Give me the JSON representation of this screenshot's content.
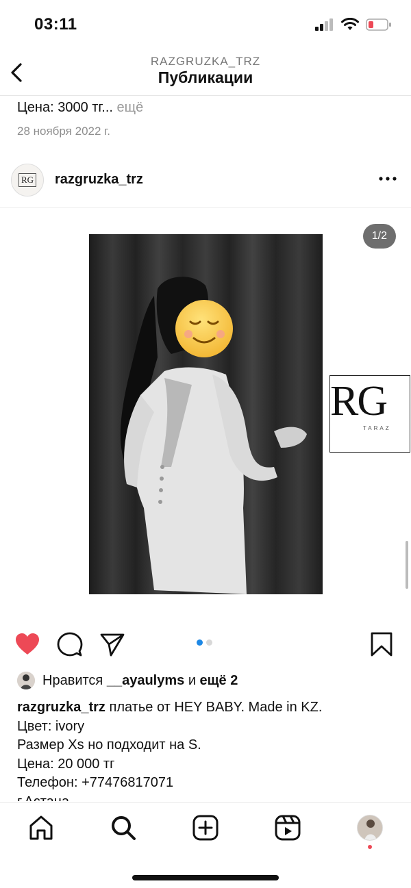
{
  "status_bar": {
    "time": "03:11"
  },
  "header": {
    "username": "RAZGRUZKA_TRZ",
    "title": "Публикации"
  },
  "previous_post": {
    "price_text": "Цена: 3000 тг...",
    "more_label": "ещё",
    "date": "28 ноября 2022 г."
  },
  "post": {
    "username": "razgruzka_trz",
    "image_counter": "1/2",
    "likes": {
      "prefix": "Нравится",
      "user": "__ayaulyms",
      "and": "и",
      "more": "ещё 2"
    },
    "caption": {
      "username": "razgruzka_trz",
      "lines": [
        "платье от HEY BABY. Made in KZ.",
        "Цвет: ivory",
        "Размер Xs но подходит на S.",
        "Цена: 20 000 тг",
        "Телефон: +77476817071",
        "г.Астана"
      ]
    }
  },
  "colors": {
    "like_red": "#ed4956",
    "dot_active": "#1e88e5"
  },
  "icons": [
    "back-icon",
    "more-icon",
    "heart-icon",
    "comment-icon",
    "share-icon",
    "bookmark-icon",
    "home-icon",
    "search-icon",
    "create-icon",
    "reels-icon"
  ]
}
